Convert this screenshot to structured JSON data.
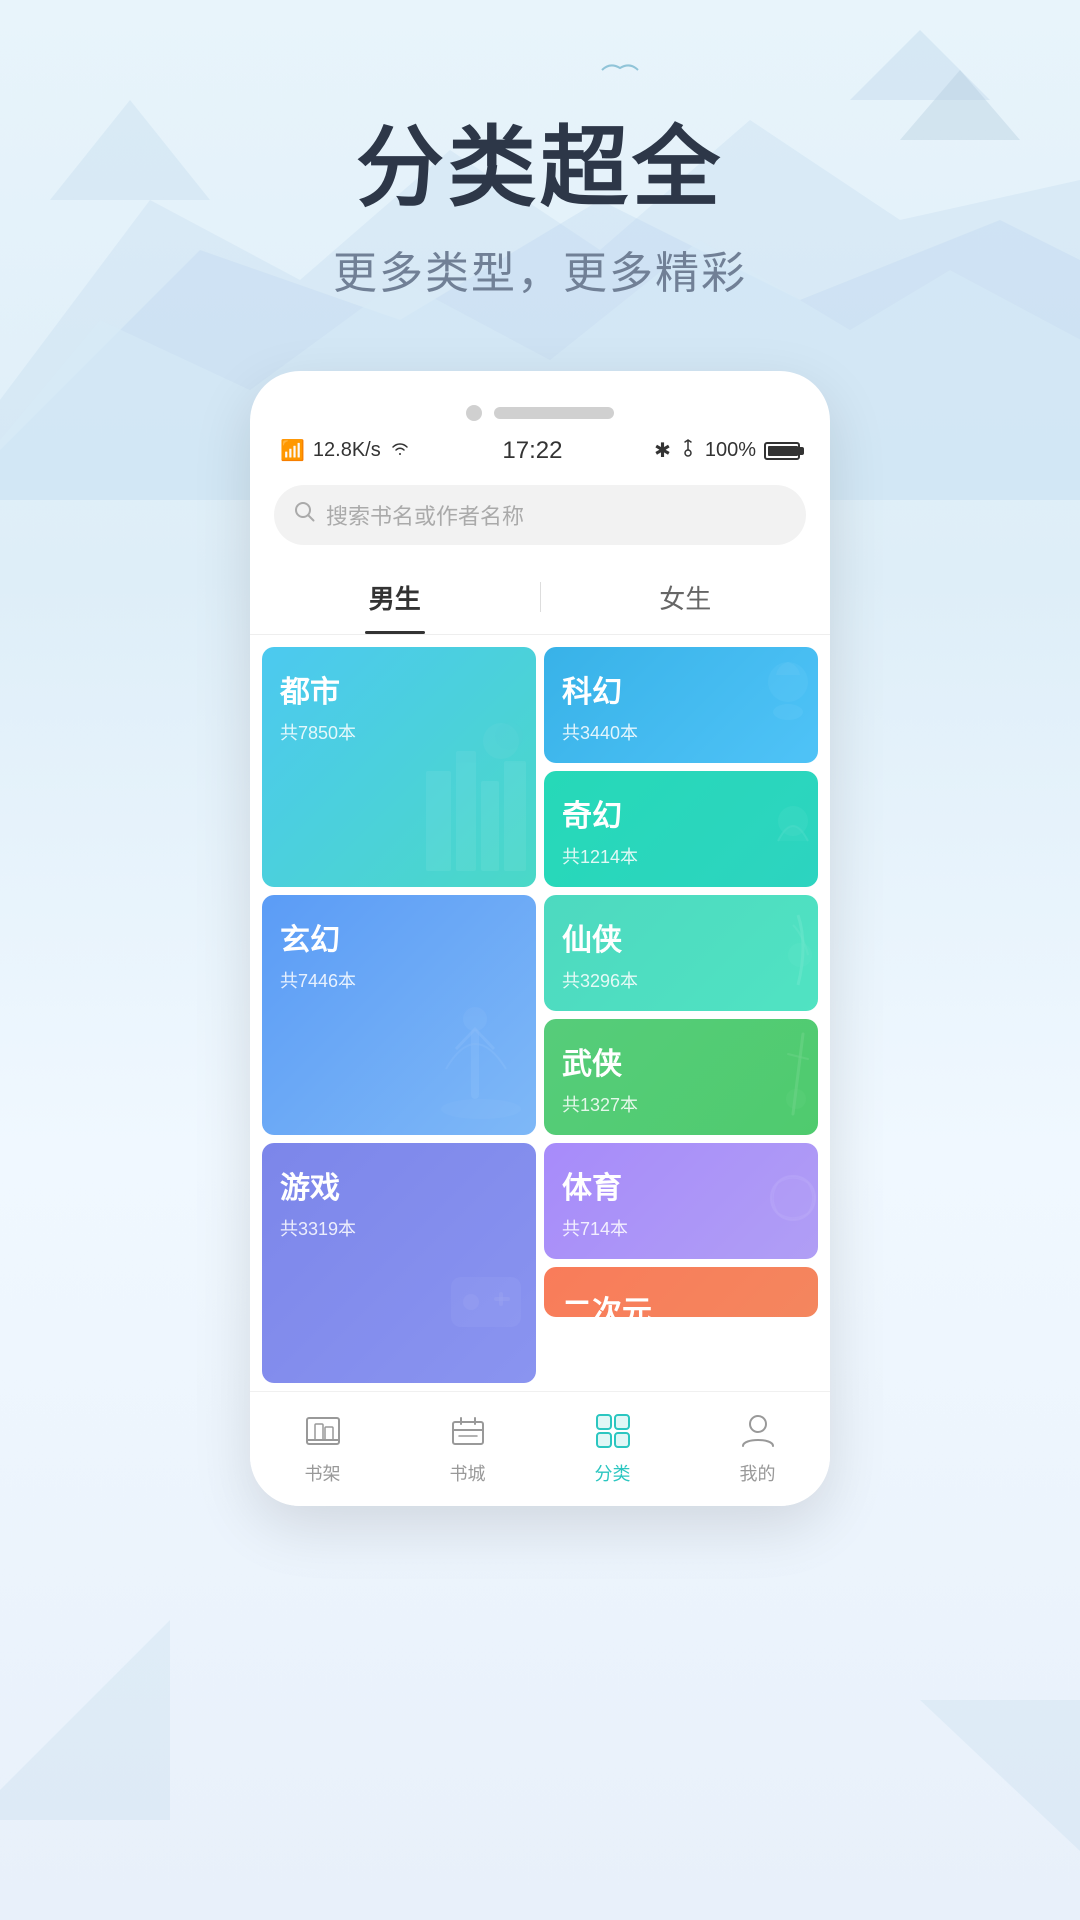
{
  "hero": {
    "title": "分类超全",
    "subtitle": "更多类型，更多精彩"
  },
  "status_bar": {
    "network": "12.8K/s",
    "wifi_icon": "wifi",
    "time": "17:22",
    "bluetooth": "✱",
    "mute_icon": "🔕",
    "battery_pct": "100%"
  },
  "search": {
    "placeholder": "搜索书名或作者名称"
  },
  "tabs": {
    "male": "男生",
    "female": "女生",
    "active": "male"
  },
  "categories": [
    {
      "id": "dushi",
      "name": "都市",
      "count": "共7850本",
      "color_class": "card-dushi",
      "size": "tall",
      "col": "left"
    },
    {
      "id": "kehuan",
      "name": "科幻",
      "count": "共3440本",
      "color_class": "card-kehuan",
      "size": "medium",
      "col": "right"
    },
    {
      "id": "qihuan",
      "name": "奇幻",
      "count": "共1214本",
      "color_class": "card-qihuan",
      "size": "medium",
      "col": "right"
    },
    {
      "id": "xuanhuan",
      "name": "玄幻",
      "count": "共7446本",
      "color_class": "card-xuanhuan",
      "size": "tall",
      "col": "left"
    },
    {
      "id": "xianxia",
      "name": "仙侠",
      "count": "共3296本",
      "color_class": "card-xianxia",
      "size": "medium",
      "col": "right"
    },
    {
      "id": "wuxia",
      "name": "武侠",
      "count": "共1327本",
      "color_class": "card-wuxia",
      "size": "medium",
      "col": "right"
    },
    {
      "id": "youxi",
      "name": "游戏",
      "count": "共3319本",
      "color_class": "card-youxi",
      "size": "tall",
      "col": "left"
    },
    {
      "id": "tiyu",
      "name": "体育",
      "count": "共714本",
      "color_class": "card-tiyu",
      "size": "medium",
      "col": "right"
    },
    {
      "id": "erciyuan",
      "name": "二次元",
      "count": "",
      "color_class": "card-erciyuan",
      "size": "partial",
      "col": "right"
    }
  ],
  "bottom_nav": {
    "items": [
      {
        "id": "shelf",
        "label": "书架",
        "active": false
      },
      {
        "id": "store",
        "label": "书城",
        "active": false
      },
      {
        "id": "categories",
        "label": "分类",
        "active": true
      },
      {
        "id": "mine",
        "label": "我的",
        "active": false
      }
    ]
  }
}
